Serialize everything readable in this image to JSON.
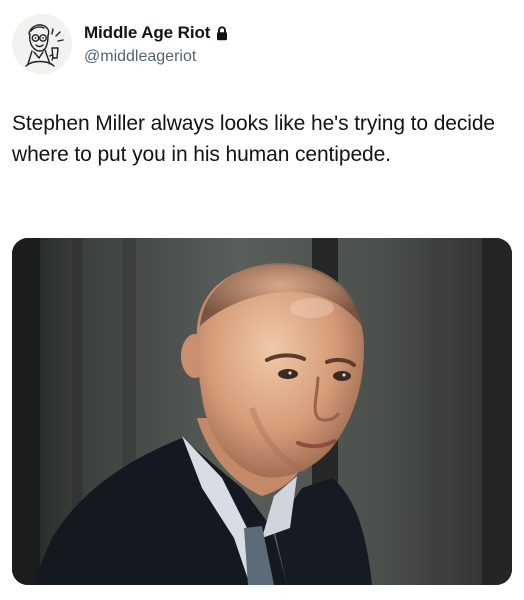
{
  "tweet": {
    "author": {
      "display_name": "Middle Age Riot",
      "handle": "@middleageriot",
      "protected": true,
      "avatar_icon": "avatar-man-with-drink-illustration",
      "badge_icon": "lock-icon"
    },
    "text": "Stephen Miller always looks like he's trying to decide where to put you in his human centipede.",
    "media": {
      "type": "photo",
      "subject": "photo-man-in-suit"
    }
  },
  "colors": {
    "text_primary": "#0f1419",
    "text_secondary": "#536471",
    "background": "#ffffff"
  }
}
